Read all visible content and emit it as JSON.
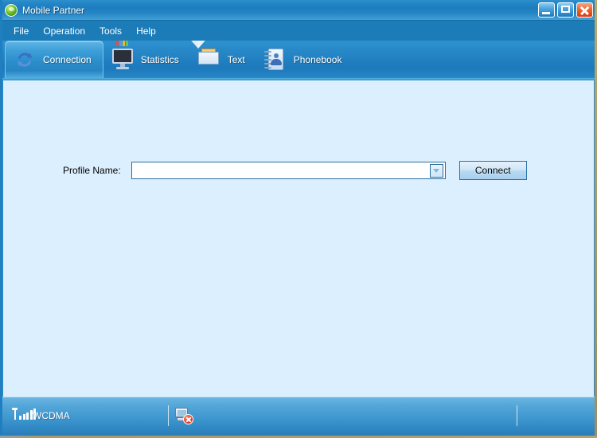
{
  "window": {
    "title": "Mobile Partner",
    "app_icon": "globe-green-icon",
    "controls": {
      "minimize": "minimize-button",
      "maximize": "maximize-button",
      "close": "close-button"
    }
  },
  "menu": {
    "items": [
      {
        "label": "File"
      },
      {
        "label": "Operation"
      },
      {
        "label": "Tools"
      },
      {
        "label": "Help"
      }
    ]
  },
  "tabs": {
    "active_index": 0,
    "items": [
      {
        "label": "Connection",
        "icon": "sync-circle-icon"
      },
      {
        "label": "Statistics",
        "icon": "monitor-barchart-icon"
      },
      {
        "label": "Text",
        "icon": "envelope-icon"
      },
      {
        "label": "Phonebook",
        "icon": "notebook-contact-icon"
      }
    ]
  },
  "main": {
    "profile": {
      "label": "Profile Name:",
      "value": "",
      "placeholder": "",
      "dropdown_icon": "chevron-down-icon"
    },
    "connect_button": {
      "label": "Connect"
    }
  },
  "status_bar": {
    "signal": {
      "icon": "signal-bars-icon",
      "bars_total": 5,
      "bars_active": 5
    },
    "network": "WCDMA",
    "connection": {
      "icon": "network-disconnected-icon",
      "state": "disconnected"
    }
  },
  "colors": {
    "title_bar": "#2385c6",
    "menu_bar": "#1c7cb8",
    "toolbar": "#2686c6",
    "content_bg": "#dcefff",
    "status_bar": "#3e97cf",
    "accent_border": "#2f8ac4",
    "close_button": "#ef6a34",
    "frame_edge": "#a8996a"
  }
}
